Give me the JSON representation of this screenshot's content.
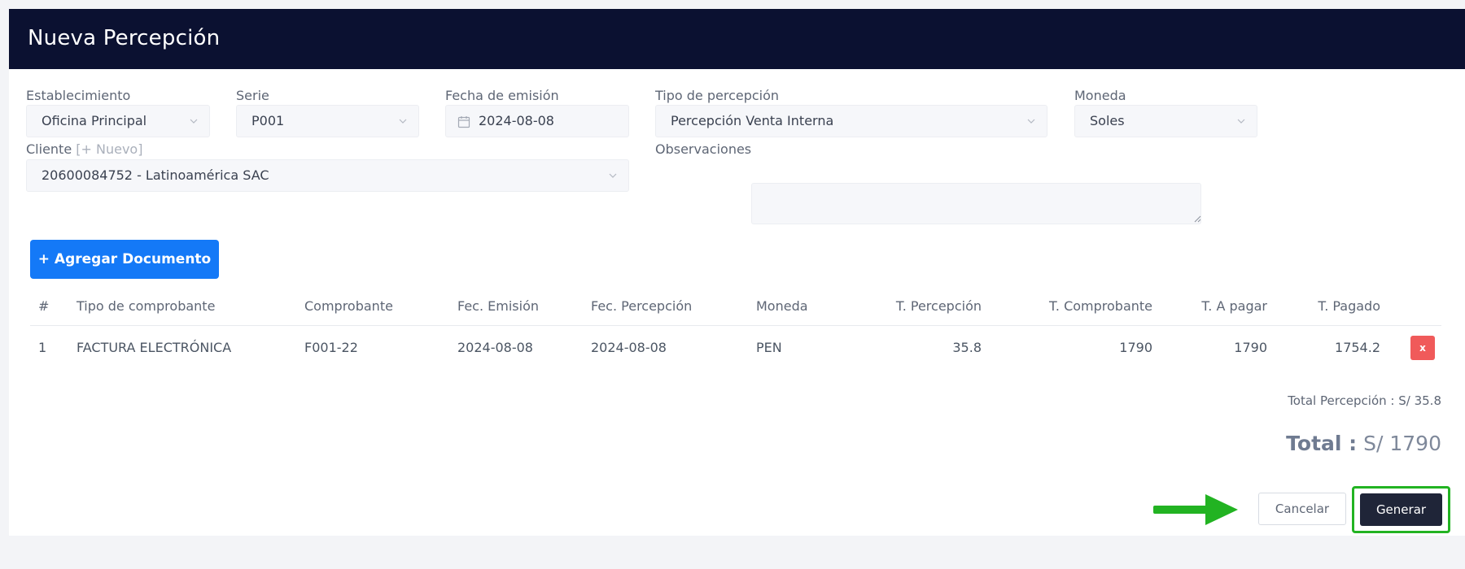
{
  "header": {
    "title": "Nueva Percepción"
  },
  "form": {
    "establecimiento": {
      "label": "Establecimiento",
      "value": "Oficina Principal"
    },
    "serie": {
      "label": "Serie",
      "value": "P001"
    },
    "fecha": {
      "label": "Fecha de emisión",
      "value": "2024-08-08"
    },
    "tipo": {
      "label": "Tipo de percepción",
      "value": "Percepción Venta Interna"
    },
    "moneda": {
      "label": "Moneda",
      "value": "Soles"
    },
    "cliente": {
      "label": "Cliente",
      "new_link": "[+ Nuevo]",
      "value": "20600084752 - Latinoamérica SAC"
    },
    "observaciones": {
      "label": "Observaciones",
      "value": ""
    }
  },
  "add_document_button": "+ Agregar Documento",
  "table": {
    "headers": [
      "#",
      "Tipo de comprobante",
      "Comprobante",
      "Fec. Emisión",
      "Fec. Percepción",
      "Moneda",
      "T. Percepción",
      "T. Comprobante",
      "T. A pagar",
      "T. Pagado"
    ],
    "rows": [
      [
        "1",
        "FACTURA ELECTRÓNICA",
        "F001-22",
        "2024-08-08",
        "2024-08-08",
        "PEN",
        "35.8",
        "1790",
        "1790",
        "1754.2"
      ]
    ],
    "delete_label": "x"
  },
  "totals": {
    "percepcion": "Total Percepción : S/ 35.8",
    "total_label": "Total :",
    "total_value": "S/ 1790"
  },
  "actions": {
    "cancel": "Cancelar",
    "generate": "Generar"
  },
  "colors": {
    "header_bg": "#0b1131",
    "primary": "#1479f7",
    "danger": "#f05a5a",
    "highlight": "#22b322"
  }
}
